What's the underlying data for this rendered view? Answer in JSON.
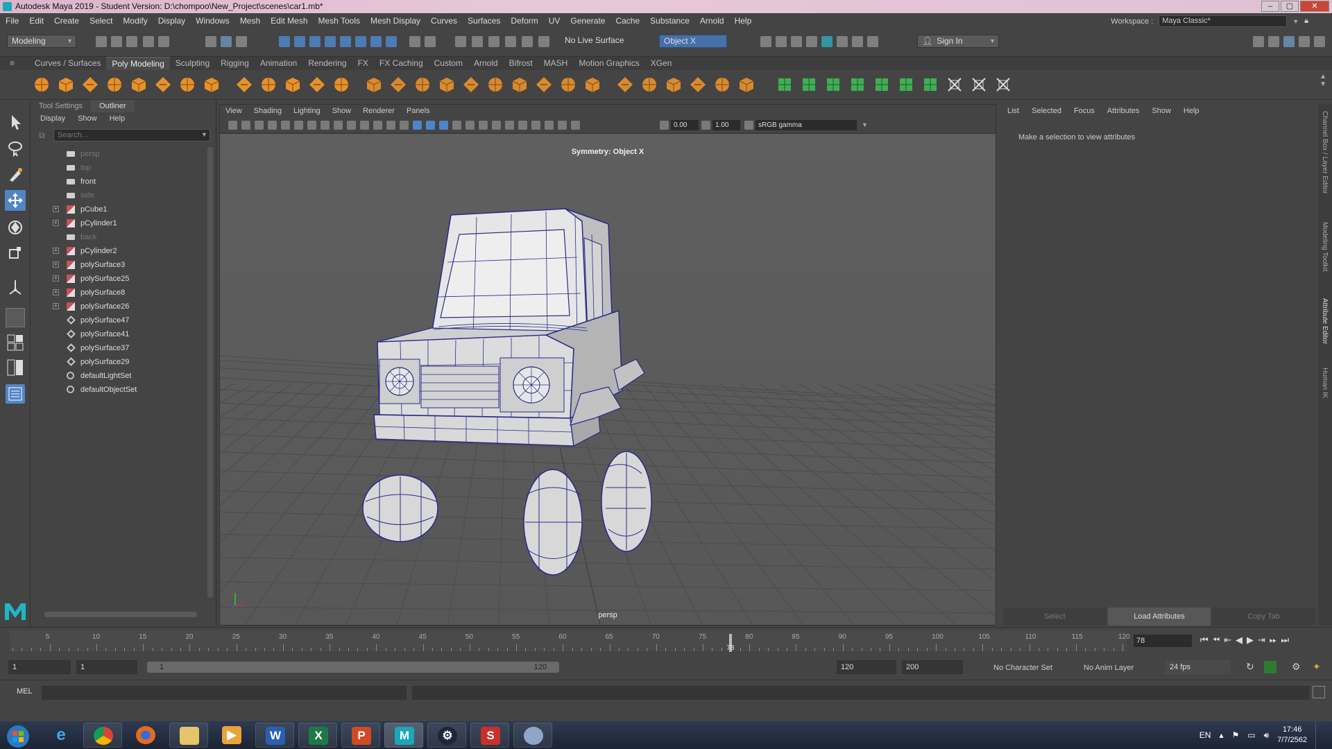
{
  "window": {
    "title": "Autodesk Maya 2019 - Student Version: D:\\chompoo\\New_Project\\scenes\\car1.mb*"
  },
  "menubar": {
    "items": [
      "File",
      "Edit",
      "Create",
      "Select",
      "Modify",
      "Display",
      "Windows",
      "Mesh",
      "Edit Mesh",
      "Mesh Tools",
      "Mesh Display",
      "Curves",
      "Surfaces",
      "Deform",
      "UV",
      "Generate",
      "Cache",
      "Substance",
      "Arnold",
      "Help"
    ]
  },
  "workspace": {
    "label": "Workspace :",
    "value": "Maya Classic*"
  },
  "statusline": {
    "mode": "Modeling",
    "live_surface": "No Live Surface",
    "symmetry": "Object X",
    "sign_in": "Sign In"
  },
  "shelf": {
    "tabs": [
      "Curves / Surfaces",
      "Poly Modeling",
      "Sculpting",
      "Rigging",
      "Animation",
      "Rendering",
      "FX",
      "FX Caching",
      "Custom",
      "Arnold",
      "Bifrost",
      "MASH",
      "Motion Graphics",
      "XGen"
    ],
    "active_tab": "Poly Modeling"
  },
  "outliner": {
    "tabs": [
      "Tool Settings",
      "Outliner"
    ],
    "menu": [
      "Display",
      "Show",
      "Help"
    ],
    "search_placeholder": "Search...",
    "items": [
      {
        "label": "persp",
        "type": "camera",
        "dim": true,
        "expand": false
      },
      {
        "label": "top",
        "type": "camera",
        "dim": true,
        "expand": false
      },
      {
        "label": "front",
        "type": "camera",
        "dim": false,
        "expand": false
      },
      {
        "label": "side",
        "type": "camera",
        "dim": true,
        "expand": false
      },
      {
        "label": "pCube1",
        "type": "mesh",
        "dim": false,
        "expand": true
      },
      {
        "label": "pCylinder1",
        "type": "mesh",
        "dim": false,
        "expand": true
      },
      {
        "label": "back",
        "type": "camera",
        "dim": true,
        "expand": false
      },
      {
        "label": "pCylinder2",
        "type": "mesh",
        "dim": false,
        "expand": true
      },
      {
        "label": "polySurface3",
        "type": "mesh",
        "dim": false,
        "expand": true
      },
      {
        "label": "polySurface25",
        "type": "mesh",
        "dim": false,
        "expand": true
      },
      {
        "label": "polySurface8",
        "type": "mesh",
        "dim": false,
        "expand": true
      },
      {
        "label": "polySurface26",
        "type": "mesh",
        "dim": false,
        "expand": true
      },
      {
        "label": "polySurface47",
        "type": "poly",
        "dim": false,
        "expand": false
      },
      {
        "label": "polySurface41",
        "type": "poly",
        "dim": false,
        "expand": false
      },
      {
        "label": "polySurface37",
        "type": "poly",
        "dim": false,
        "expand": false
      },
      {
        "label": "polySurface29",
        "type": "poly",
        "dim": false,
        "expand": false
      },
      {
        "label": "defaultLightSet",
        "type": "set",
        "dim": false,
        "expand": false
      },
      {
        "label": "defaultObjectSet",
        "type": "set",
        "dim": false,
        "expand": false
      }
    ]
  },
  "viewport": {
    "menu": [
      "View",
      "Shading",
      "Lighting",
      "Show",
      "Renderer",
      "Panels"
    ],
    "exposure": "0.00",
    "gamma": "1.00",
    "color_space": "sRGB gamma",
    "symmetry_label": "Symmetry: Object X",
    "camera_label": "persp"
  },
  "attribute_editor": {
    "menu": [
      "List",
      "Selected",
      "Focus",
      "Attributes",
      "Show",
      "Help"
    ],
    "message": "Make a selection to view attributes",
    "buttons": [
      "Select",
      "Load Attributes",
      "Copy Tab"
    ],
    "side_tabs": [
      "Channel Box / Layer Editor",
      "Modeling Toolkit",
      "Attribute Editor",
      "Human IK"
    ]
  },
  "timeline": {
    "ticks": [
      "5",
      "10",
      "15",
      "20",
      "25",
      "30",
      "35",
      "40",
      "45",
      "50",
      "55",
      "60",
      "65",
      "70",
      "75",
      "80",
      "85",
      "90",
      "95",
      "100",
      "105",
      "110",
      "115",
      "120"
    ],
    "current_frame": "78",
    "current_frame_field": "78",
    "range_start": 1,
    "range_end": 120
  },
  "range": {
    "start": "1",
    "playback_start": "1",
    "bar_start": "1",
    "bar_end": "120",
    "playback_end": "120",
    "end": "200",
    "character_set": "No Character Set",
    "anim_layer": "No Anim Layer",
    "fps": "24 fps"
  },
  "command": {
    "lang": "MEL"
  },
  "taskbar": {
    "lang": "EN",
    "time": "17:46",
    "date": "7/7/2562",
    "colors": {
      "start": "#2a79c5",
      "word": "#2b5fb4",
      "excel": "#1e7a45",
      "ppt": "#d04a25",
      "maya": "#1aa8b8",
      "steam": "#1b2838"
    }
  }
}
